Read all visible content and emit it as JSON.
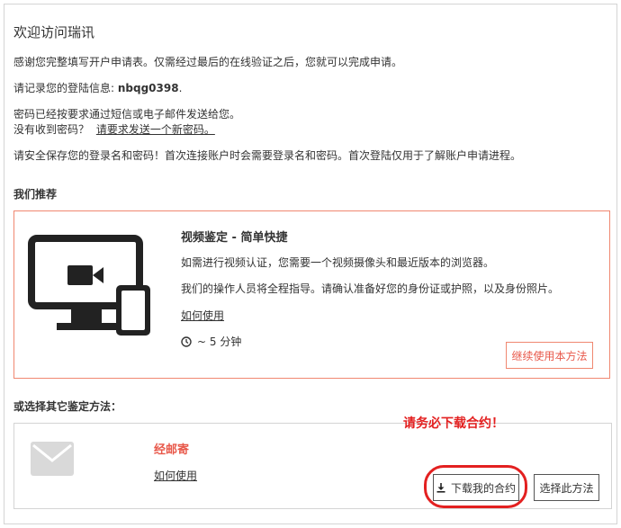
{
  "header": {
    "title": "欢迎访问瑞讯"
  },
  "intro": {
    "line1": "感谢您完整填写开户申请表。仅需经过最后的在线验证之后，您就可以完成申请。",
    "login_prefix": "请记录您的登陆信息: ",
    "login_id": "nbqg0398",
    "login_suffix": ".",
    "password_sent": "密码已经按要求通过短信或电子邮件发送给您。",
    "not_received": "没有收到密码？",
    "request_new_link": "请要求发送一个新密码。",
    "security_note": "请安全保存您的登录名和密码！首次连接账户时会需要登录名和密码。首次登陆仅用于了解账户申请进程。"
  },
  "recommend": {
    "heading": "我们推荐",
    "card_title": "视频鉴定 - 简单快捷",
    "line1": "如需进行视频认证，您需要一个视频摄像头和最近版本的浏览器。",
    "line2": "我们的操作人员将全程指导。请确认准备好您的身份证或护照，以及身份照片。",
    "how_to_link": "如何使用",
    "duration": "~ 5 分钟",
    "continue_button": "继续使用本方法",
    "icon": "computer-phone-video-icon"
  },
  "other": {
    "heading": "或选择其它鉴定方法：",
    "mail_title": "经邮寄",
    "how_to_link": "如何使用",
    "download_button": "下载我的合约",
    "choose_button": "选择此方法",
    "icon": "envelope-icon"
  },
  "annotation": {
    "text": "请务必下载合约！",
    "color": "#e32020"
  },
  "colors": {
    "accent": "#e8584a",
    "accent_border": "#f08770"
  }
}
